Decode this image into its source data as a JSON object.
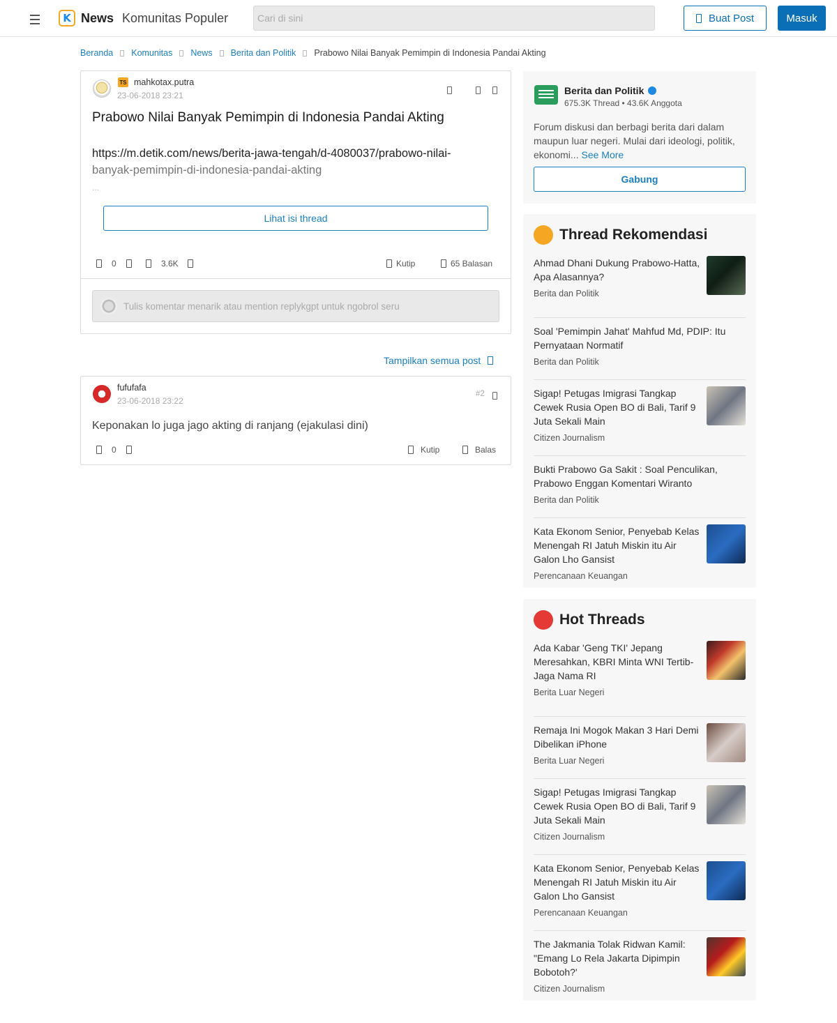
{
  "header": {
    "brand": "News",
    "nav_link": "Komunitas Populer",
    "search_placeholder": "Cari di sini",
    "create_post_label": "Buat Post",
    "login_label": "Masuk",
    "accent_color": "#0b6fb8"
  },
  "breadcrumb": {
    "items": [
      "Beranda",
      "Komunitas",
      "News",
      "Berita dan Politik"
    ],
    "current": "Prabowo Nilai Banyak Pemimpin di Indonesia Pandai Akting"
  },
  "thread": {
    "ts_badge": "TS",
    "username": "mahkotax.putra",
    "timestamp": "23-06-2018 23:21",
    "title": "Prabowo Nilai Banyak Pemimpin di Indonesia Pandai Akting",
    "link_line1": "https://m.detik.com/news/berita-jawa-tengah/d-4080037/prabowo-nilai-",
    "link_line2": "banyak-pemimpin-di-indonesia-pandai-akting",
    "ellipsis": "...",
    "view_button": "Lihat isi thread",
    "vote_count": "0",
    "view_count": "3.6K",
    "quote_label": "Kutip",
    "replies_label": "65 Balasan",
    "comment_placeholder": "Tulis komentar menarik atau mention replykgpt untuk ngobrol seru"
  },
  "show_all_label": "Tampilkan semua post",
  "reply": {
    "username": "fufufafa",
    "timestamp": "23-06-2018 23:22",
    "post_number": "#2",
    "text": "Keponakan lo juga jago akting di ranjang (ejakulasi dini)",
    "vote_count": "0",
    "quote_label": "Kutip",
    "reply_label": "Balas"
  },
  "category": {
    "name": "Berita dan Politik",
    "stats": "675.3K Thread • 43.6K Anggota",
    "description": "Forum diskusi dan berbagi berita dari dalam maupun luar negeri. Mulai dari ideologi, politik, ekonomi...",
    "see_more": "See More",
    "join_label": "Gabung"
  },
  "recommendations": {
    "title": "Thread Rekomendasi",
    "items": [
      {
        "title": "Ahmad Dhani Dukung Prabowo-Hatta, Apa Alasannya?",
        "category": "Berita dan Politik"
      },
      {
        "title": "Soal 'Pemimpin Jahat' Mahfud Md, PDIP: Itu Pernyataan Normatif",
        "category": "Berita dan Politik"
      },
      {
        "title": "Sigap! Petugas Imigrasi Tangkap Cewek Rusia Open BO di Bali, Tarif 9 Juta Sekali Main",
        "category": "Citizen Journalism"
      },
      {
        "title": "Bukti Prabowo Ga Sakit : Soal Penculikan, Prabowo Enggan Komentari Wiranto",
        "category": "Berita dan Politik"
      },
      {
        "title": "Kata Ekonom Senior, Penyebab Kelas Menengah RI Jatuh Miskin itu Air Galon Lho Gansist",
        "category": "Perencanaan Keuangan"
      }
    ]
  },
  "hot_threads": {
    "title": "Hot Threads",
    "items": [
      {
        "title": "Ada Kabar 'Geng TKI' Jepang Meresahkan, KBRI Minta WNI Tertib-Jaga Nama RI",
        "category": "Berita Luar Negeri"
      },
      {
        "title": "Remaja Ini Mogok Makan 3 Hari Demi Dibelikan iPhone",
        "category": "Berita Luar Negeri"
      },
      {
        "title": "Sigap! Petugas Imigrasi Tangkap Cewek Rusia Open BO di Bali, Tarif 9 Juta Sekali Main",
        "category": "Citizen Journalism"
      },
      {
        "title": "Kata Ekonom Senior, Penyebab Kelas Menengah RI Jatuh Miskin itu Air Galon Lho Gansist",
        "category": "Perencanaan Keuangan"
      },
      {
        "title": "The Jakmania Tolak Ridwan Kamil: \"Emang Lo Rela Jakarta Dipimpin Bobotoh?'",
        "category": "Citizen Journalism"
      }
    ]
  }
}
